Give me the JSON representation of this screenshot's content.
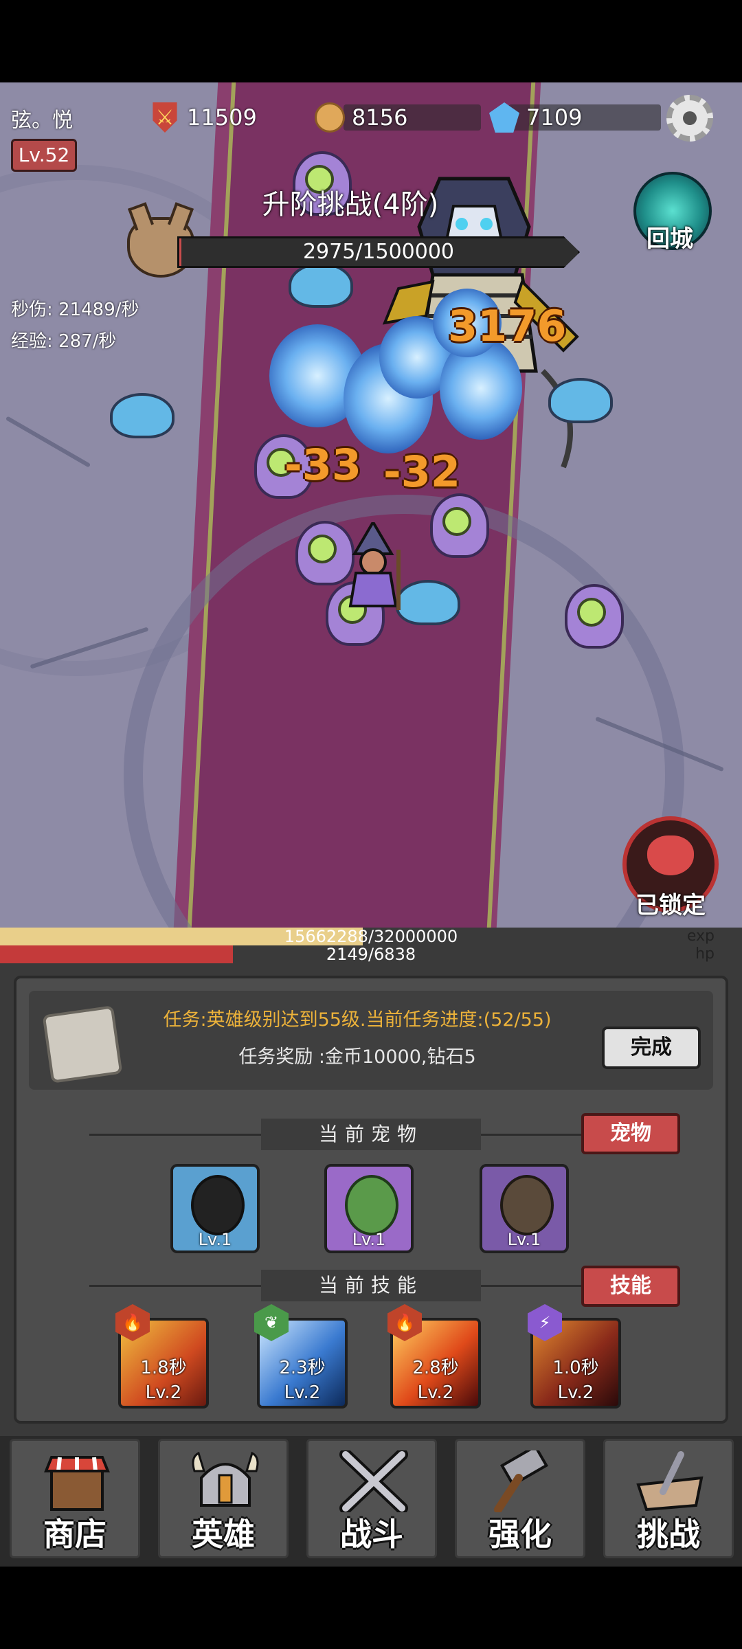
{
  "player": {
    "name": "弦。悦",
    "level": "Lv.52"
  },
  "resources": {
    "power": "11509",
    "coins": "8156",
    "gems": "7109"
  },
  "boss": {
    "title": "升阶挑战(4阶)",
    "hp_text": "2975/1500000",
    "hp_fraction": 0.002
  },
  "return_button": {
    "label": "回城"
  },
  "stats": {
    "dps": "秒伤: 21489/秒",
    "exp": "经验: 287/秒"
  },
  "damage_numbers": [
    "3176",
    "-33",
    "-32"
  ],
  "lock_button": {
    "label": "已锁定"
  },
  "exp_bar": {
    "text": "15662288/32000000",
    "tag": "exp",
    "fraction": 0.489
  },
  "hp_bar": {
    "text": "2149/6838",
    "tag": "hp",
    "fraction": 0.314
  },
  "task": {
    "text": "任务:英雄级别达到55级.当前任务进度:(52/55)",
    "reward": "任务奖励 :金币10000,钻石5",
    "button": "完成"
  },
  "pets": {
    "title": "当前宠物",
    "button": "宠物",
    "items": [
      {
        "name": "penguin",
        "level": "Lv.1"
      },
      {
        "name": "turtle",
        "level": "Lv.1"
      },
      {
        "name": "rock-crab",
        "level": "Lv.1"
      }
    ]
  },
  "skills": {
    "title": "当前技能",
    "button": "技能",
    "items": [
      {
        "element": "fire",
        "cooldown": "1.8秒",
        "level": "Lv.2"
      },
      {
        "element": "leaf",
        "cooldown": "2.3秒",
        "level": "Lv.2"
      },
      {
        "element": "fire",
        "cooldown": "2.8秒",
        "level": "Lv.2"
      },
      {
        "element": "lightning",
        "cooldown": "1.0秒",
        "level": "Lv.2"
      }
    ]
  },
  "nav": [
    {
      "label": "商店",
      "icon": "shop-icon"
    },
    {
      "label": "英雄",
      "icon": "helmet-icon"
    },
    {
      "label": "战斗",
      "icon": "swords-icon"
    },
    {
      "label": "强化",
      "icon": "hammer-icon"
    },
    {
      "label": "挑战",
      "icon": "anvil-icon"
    }
  ],
  "colors": {
    "exp": "#e9cf8a",
    "hp": "#c43a3a",
    "task": "#ecb23a",
    "red_button": "#c84b4b"
  }
}
